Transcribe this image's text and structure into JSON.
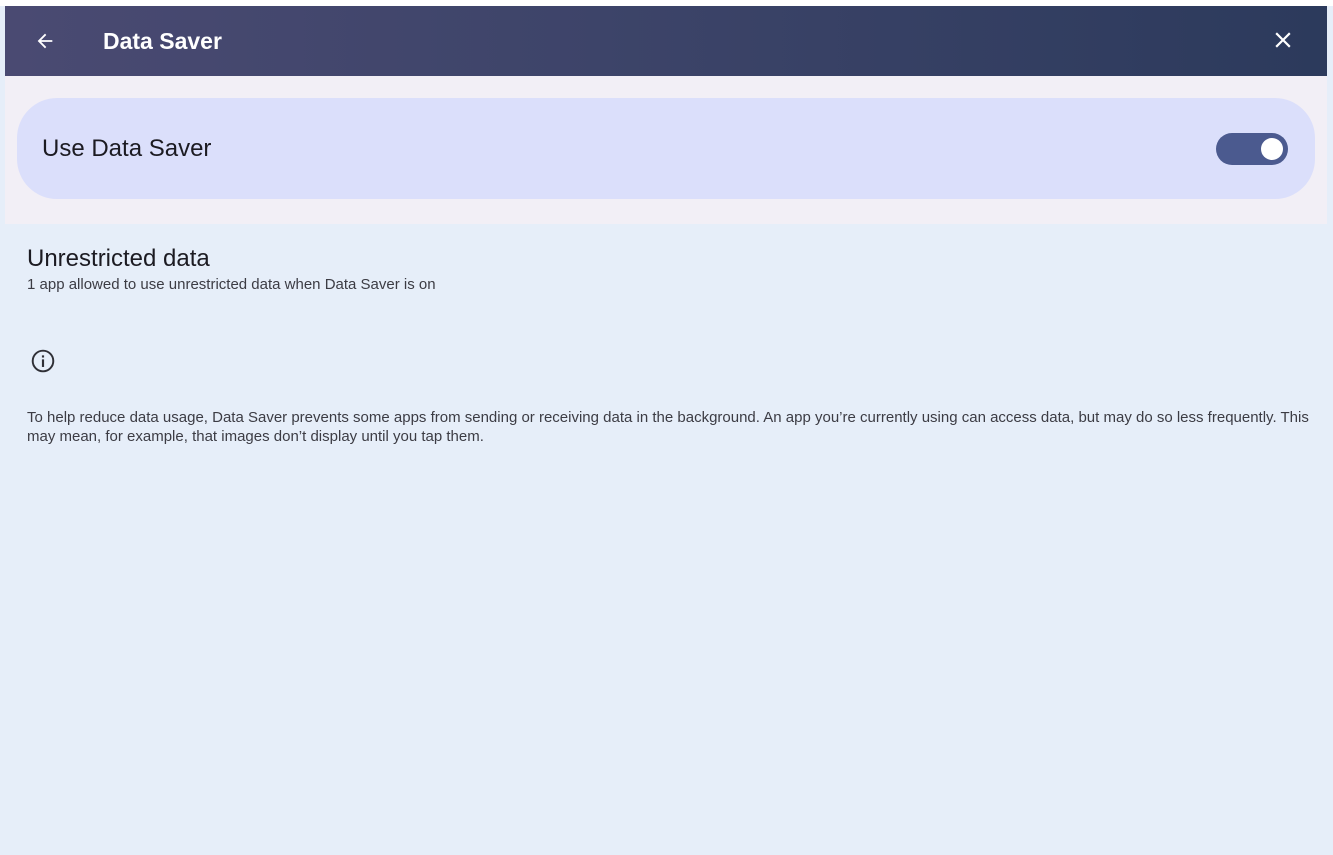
{
  "app_bar": {
    "title": "Data Saver",
    "back_icon": "arrow-left-icon",
    "close_icon": "close-icon",
    "gradient_colors": [
      "#4a4a72",
      "#2c3a5c"
    ]
  },
  "data_saver_toggle": {
    "label": "Use Data Saver",
    "checked": true,
    "track_color": "#4b5a8f",
    "card_color": "#dbdffb"
  },
  "unrestricted_data": {
    "title": "Unrestricted data",
    "summary": "1 app allowed to use unrestricted data when Data Saver is on"
  },
  "footer": {
    "icon": "info-icon",
    "text": "To help reduce data usage, Data Saver prevents some apps from sending or receiving data in the background. An app you’re currently using can access data, but may do so less frequently. This may mean, for example, that images don’t display until you tap them."
  }
}
